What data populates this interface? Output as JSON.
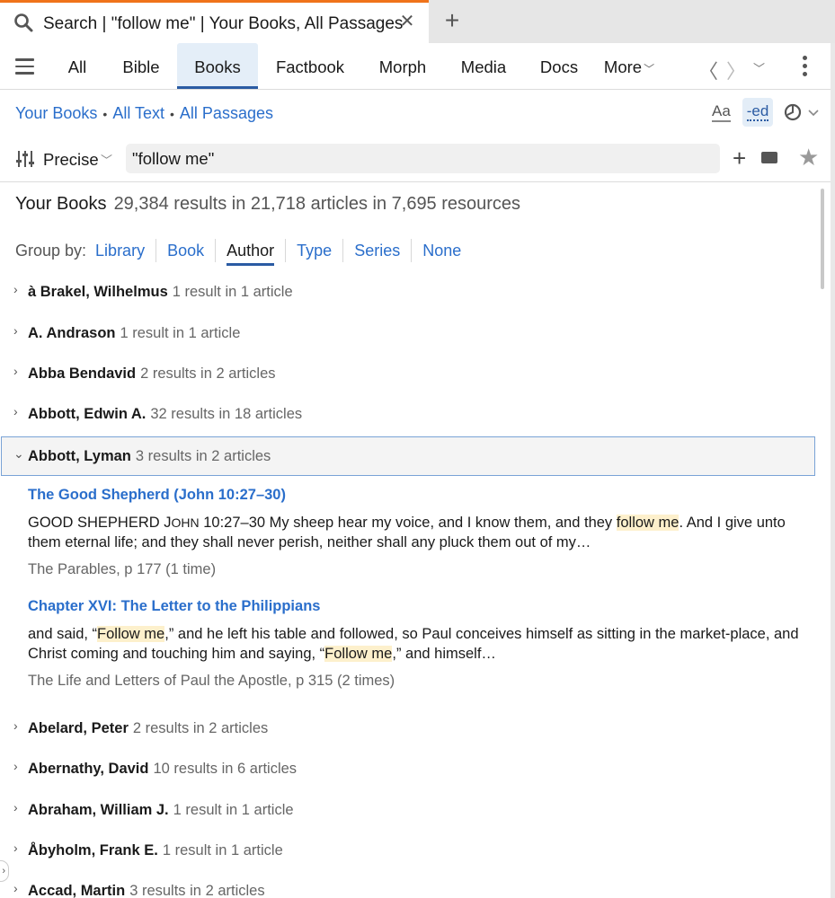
{
  "tab": {
    "title": "Search | \"follow me\" | Your Books, All Passages",
    "close": "✕",
    "new_tab": "+",
    "accent_color": "#f0731a"
  },
  "nav": {
    "tabs": [
      "All",
      "Bible",
      "Books",
      "Factbook",
      "Morph",
      "Media",
      "Docs"
    ],
    "active_tab": "Books",
    "more_label": "More",
    "back_icon": "chevron-left-icon",
    "forward_icon": "chevron-right-icon"
  },
  "scope": {
    "your_books": "Your Books",
    "all_text": "All Text",
    "all_passages": "All Passages",
    "separator": "•"
  },
  "tools": {
    "font": "Aa",
    "ed": "-ed"
  },
  "search": {
    "mode": "Precise",
    "query": "\"follow me\""
  },
  "summary": {
    "heading": "Your Books",
    "counts": "29,384 results in 21,718 articles in 7,695 resources"
  },
  "groupby": {
    "label": "Group by:",
    "options": [
      "Library",
      "Book",
      "Author",
      "Type",
      "Series",
      "None"
    ],
    "active": "Author"
  },
  "authors": [
    {
      "name": "à Brakel, Wilhelmus",
      "count": "1 result in 1 article"
    },
    {
      "name": "A. Andrason",
      "count": "1 result in 1 article"
    },
    {
      "name": "Abba Bendavid",
      "count": "2 results in 2 articles"
    },
    {
      "name": "Abbott, Edwin A.",
      "count": "32 results in 18 articles"
    },
    {
      "name": "Abbott, Lyman",
      "count": "3 results in 2 articles",
      "expanded": true
    },
    {
      "name": "Abelard, Peter",
      "count": "2 results in 2 articles"
    },
    {
      "name": "Abernathy, David",
      "count": "10 results in 6 articles"
    },
    {
      "name": "Abraham, William J.",
      "count": "1 result in 1 article"
    },
    {
      "name": "Åbyholm, Frank E.",
      "count": "1 result in 1 article"
    },
    {
      "name": "Accad, Martin",
      "count": "3 results in 2 articles"
    }
  ],
  "results": [
    {
      "title": "The Good Shepherd (John 10:27–30)",
      "text_parts": [
        "GOOD SHEPHERD J",
        "OHN",
        " 10:27–30 My sheep hear my voice, and I know them, and they ",
        "follow me",
        ". And I give unto them eternal life; and they shall never perish, neither shall any pluck them out of my…"
      ],
      "source": "The Parables, p 177 (1 time)"
    },
    {
      "title": "Chapter XVI: The Letter to the Philippians",
      "text_parts": [
        "and said, “",
        "Follow me",
        ",” and he left his table and followed, so Paul conceives himself as sitting in the market-place, and Christ coming and touching him and saying, “",
        "Follow me",
        ",” and himself…"
      ],
      "source": "The Life and Letters of Paul the Apostle, p 315 (2 times)"
    }
  ]
}
